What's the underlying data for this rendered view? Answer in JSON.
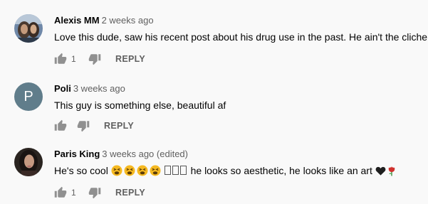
{
  "comments": [
    {
      "author": "Alexis MM",
      "date": "2 weeks ago",
      "text": "Love this dude, saw his recent post about his drug use in the past. He ain't the cliche",
      "likes": "1",
      "reply_label": "REPLY",
      "avatar": "photo"
    },
    {
      "author": "Poli",
      "date": "3 weeks ago",
      "text": "This guy is something else, beautiful af",
      "likes": "",
      "reply_label": "REPLY",
      "avatar_letter": "P",
      "avatar_color": "#607d8b"
    },
    {
      "author": "Paris King",
      "date": "3 weeks ago (edited)",
      "text_before": "He's so cool",
      "text_after": "he looks so aesthetic, he looks like an art",
      "emojis": [
        "tired-face-emoji",
        "tired-face-emoji",
        "tired-face-emoji",
        "tired-face-emoji"
      ],
      "missing_glyphs": 3,
      "trailing_emojis": [
        "black-heart-emoji",
        "rose-emoji"
      ],
      "likes": "1",
      "reply_label": "REPLY",
      "avatar": "photo"
    }
  ],
  "colors": {
    "background": "#f9f9f9",
    "text": "#030303",
    "secondary": "#606060",
    "icon": "#909090"
  }
}
